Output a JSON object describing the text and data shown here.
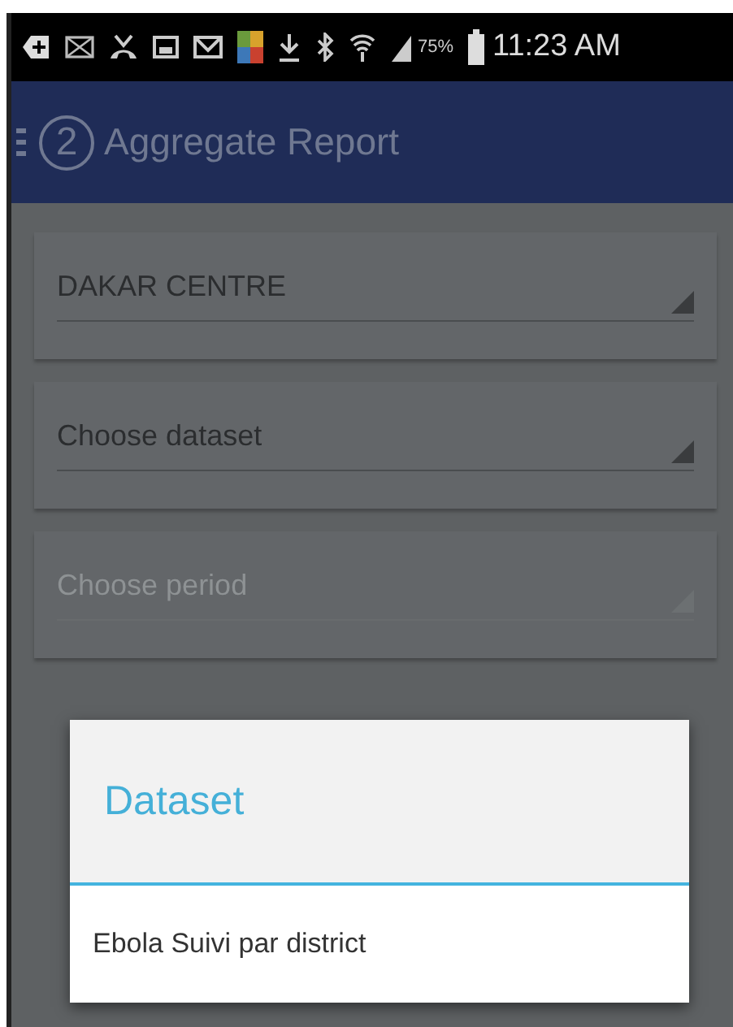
{
  "status_bar": {
    "battery_text": "75%",
    "time": "11:23 AM"
  },
  "app_bar": {
    "step": "2",
    "title": "Aggregate Report"
  },
  "spinners": [
    {
      "text": "DAKAR CENTRE",
      "disabled": false
    },
    {
      "text": "Choose dataset",
      "disabled": false
    },
    {
      "text": "Choose period",
      "disabled": true
    }
  ],
  "dialog": {
    "title": "Dataset",
    "items": [
      "Ebola Suivi par district"
    ]
  }
}
